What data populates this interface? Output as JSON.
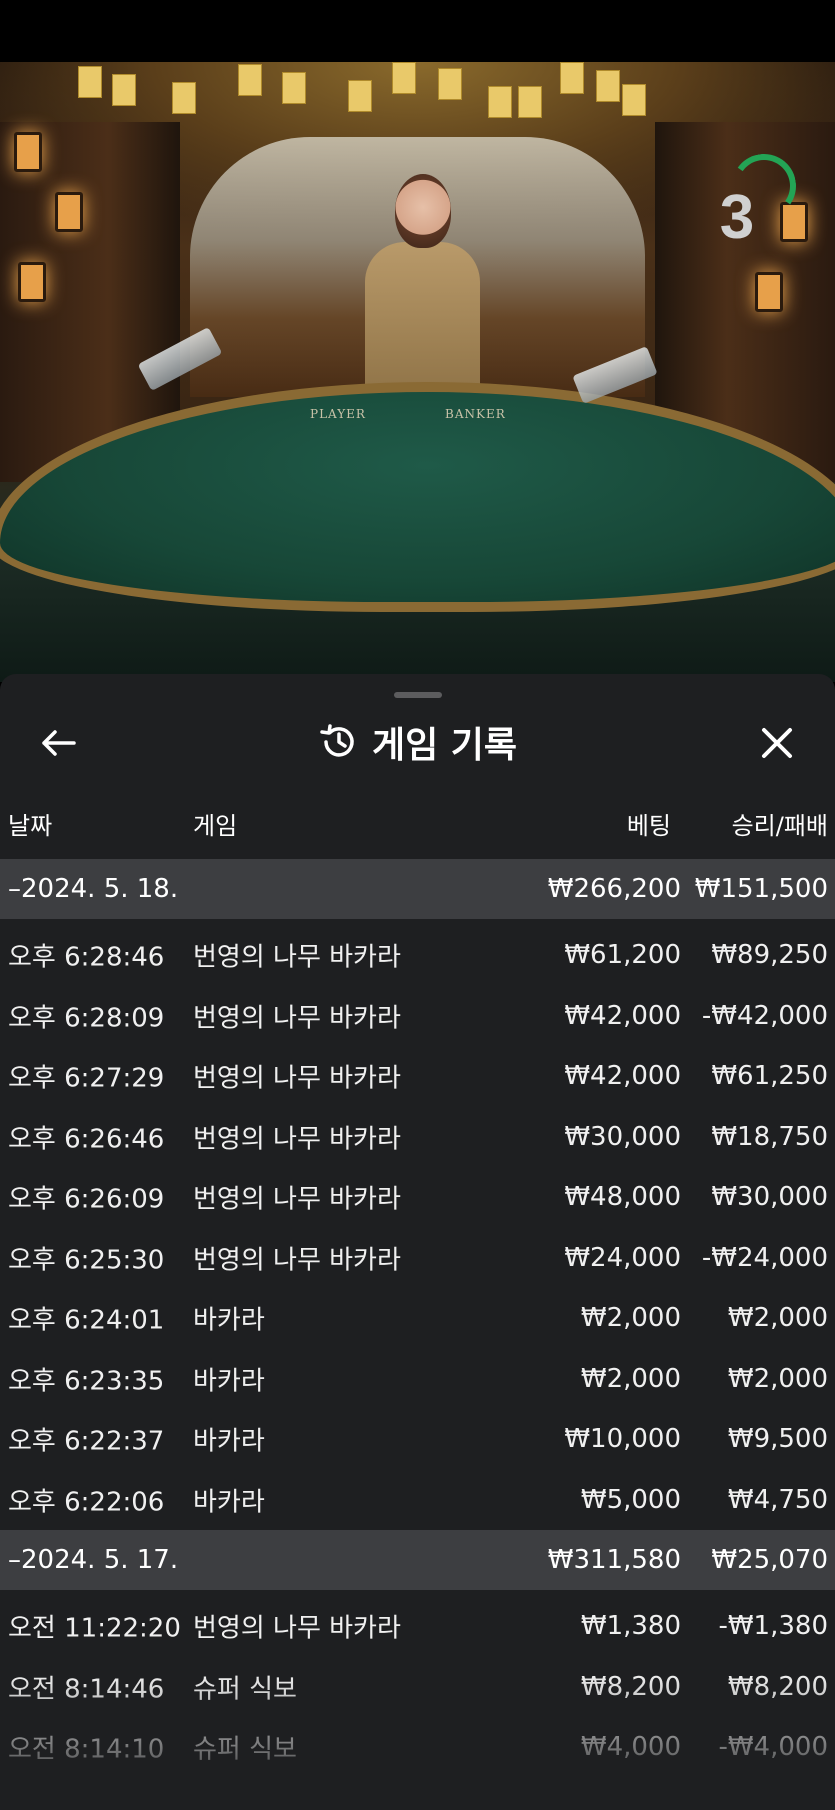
{
  "video": {
    "countdown": "3",
    "table_labels": [
      "PLAYER",
      "BANKER"
    ]
  },
  "panel": {
    "title": "게임 기록",
    "icons": {
      "back": "arrow-left-icon",
      "history": "history-icon",
      "close": "close-icon"
    },
    "columns": {
      "date": "날짜",
      "game": "게임",
      "bet": "베팅",
      "winloss": "승리/패배"
    },
    "groups": [
      {
        "date": "–2024. 5. 18.",
        "bet_total": "₩266,200",
        "win_total": "₩151,500",
        "rows": [
          {
            "time": "오후 6:28:46",
            "game": "번영의 나무 바카라",
            "bet": "₩61,200",
            "result": "₩89,250"
          },
          {
            "time": "오후 6:28:09",
            "game": "번영의 나무 바카라",
            "bet": "₩42,000",
            "result": "-₩42,000"
          },
          {
            "time": "오후 6:27:29",
            "game": "번영의 나무 바카라",
            "bet": "₩42,000",
            "result": "₩61,250"
          },
          {
            "time": "오후 6:26:46",
            "game": "번영의 나무 바카라",
            "bet": "₩30,000",
            "result": "₩18,750"
          },
          {
            "time": "오후 6:26:09",
            "game": "번영의 나무 바카라",
            "bet": "₩48,000",
            "result": "₩30,000"
          },
          {
            "time": "오후 6:25:30",
            "game": "번영의 나무 바카라",
            "bet": "₩24,000",
            "result": "-₩24,000"
          },
          {
            "time": "오후 6:24:01",
            "game": "바카라",
            "bet": "₩2,000",
            "result": "₩2,000"
          },
          {
            "time": "오후 6:23:35",
            "game": "바카라",
            "bet": "₩2,000",
            "result": "₩2,000"
          },
          {
            "time": "오후 6:22:37",
            "game": "바카라",
            "bet": "₩10,000",
            "result": "₩9,500"
          },
          {
            "time": "오후 6:22:06",
            "game": "바카라",
            "bet": "₩5,000",
            "result": "₩4,750"
          }
        ]
      },
      {
        "date": "–2024. 5. 17.",
        "bet_total": "₩311,580",
        "win_total": "₩25,070",
        "rows": [
          {
            "time": "오전 11:22:20",
            "game": "번영의 나무 바카라",
            "bet": "₩1,380",
            "result": "-₩1,380"
          },
          {
            "time": "오전 8:14:46",
            "game": "슈퍼 식보",
            "bet": "₩8,200",
            "result": "₩8,200"
          },
          {
            "time": "오전 8:14:10",
            "game": "슈퍼 식보",
            "bet": "₩4,000",
            "result": "-₩4,000"
          }
        ]
      }
    ]
  }
}
